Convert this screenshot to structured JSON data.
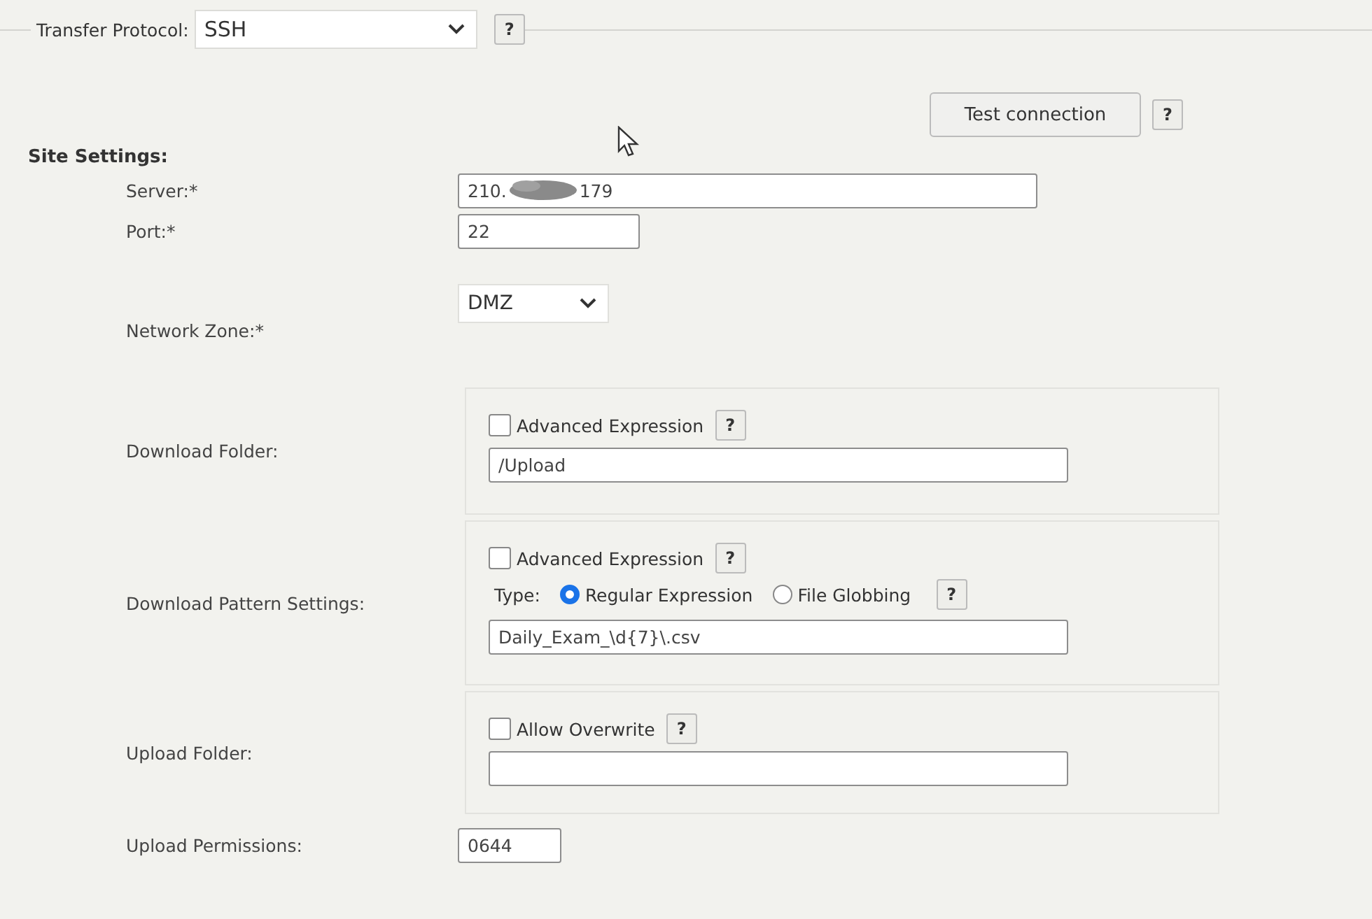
{
  "protocol": {
    "label": "Transfer Protocol:",
    "value": "SSH",
    "help": "?"
  },
  "test_button": {
    "label": "Test connection",
    "help": "?"
  },
  "section_title": "Site Settings:",
  "server": {
    "label": "Server:*",
    "value_start": "210.",
    "value_end": "179"
  },
  "port": {
    "label": "Port:*",
    "value": "22"
  },
  "network_zone": {
    "label": "Network Zone:*",
    "value": "DMZ"
  },
  "download_folder": {
    "label": "Download Folder:",
    "option": {
      "label": "Advanced Expression",
      "checked": false,
      "help": "?"
    },
    "value": "/Upload"
  },
  "download_pattern": {
    "label": "Download Pattern Settings:",
    "option": {
      "label": "Advanced Expression",
      "checked": false,
      "help": "?"
    },
    "type_label": "Type:",
    "types": [
      {
        "label": "Regular Expression",
        "selected": true
      },
      {
        "label": "File Globbing",
        "selected": false
      }
    ],
    "help": "?",
    "value": "Daily_Exam_\\d{7}\\.csv"
  },
  "upload_folder": {
    "label": "Upload Folder:",
    "option": {
      "label": "Allow Overwrite",
      "checked": false,
      "help": "?"
    }
  },
  "upload_permissions": {
    "label": "Upload Permissions:",
    "value": "0644"
  }
}
